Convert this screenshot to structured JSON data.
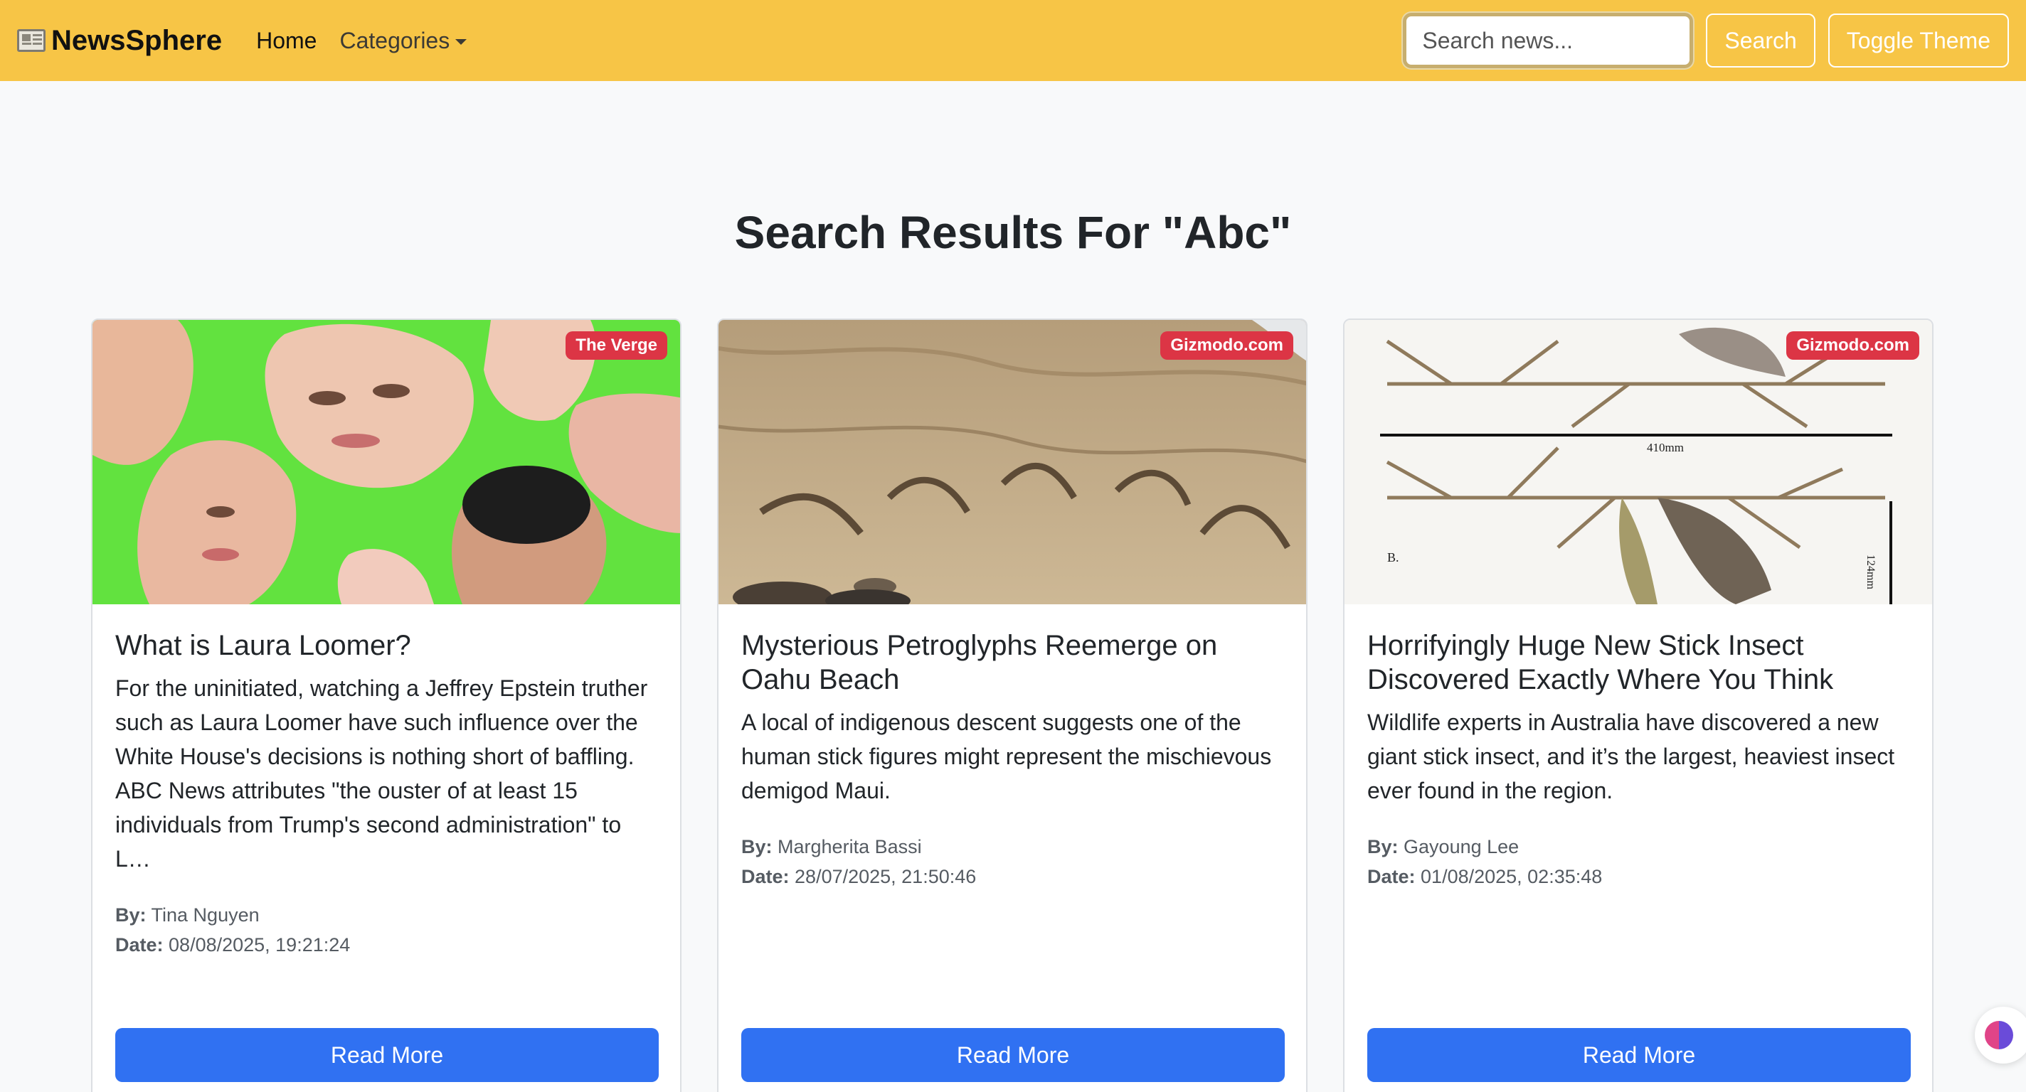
{
  "navbar": {
    "brand": "NewsSphere",
    "home": "Home",
    "categories": "Categories",
    "search_placeholder": "Search news...",
    "search_button": "Search",
    "toggle_theme": "Toggle Theme"
  },
  "heading": "Search Results For \"Abc\"",
  "cards": [
    {
      "source": "The Verge",
      "title": "What is Laura Loomer?",
      "description": "For the uninitiated, watching a Jeffrey Epstein truther such as Laura Loomer have such influence over the White House's decisions is nothing short of baffling. ABC News attributes \"the ouster of at least 15 individuals from Trump's second administration\" to L…",
      "author_label": "By:",
      "author": "Tina Nguyen",
      "date_label": "Date:",
      "date": "08/08/2025, 19:21:24",
      "button": "Read More"
    },
    {
      "source": "Gizmodo.com",
      "title": "Mysterious Petroglyphs Reemerge on Oahu Beach",
      "description": "A local of indigenous descent suggests one of the human stick figures might represent the mischievous demigod Maui.",
      "author_label": "By:",
      "author": "Margherita Bassi",
      "date_label": "Date:",
      "date": "28/07/2025, 21:50:46",
      "button": "Read More"
    },
    {
      "source": "Gizmodo.com",
      "title": "Horrifyingly Huge New Stick Insect Discovered Exactly Where You Think",
      "description": "Wildlife experts in Australia have discovered a new giant stick insect, and it’s the largest, heaviest insect ever found in the region.",
      "author_label": "By:",
      "author": "Gayoung Lee",
      "date_label": "Date:",
      "date": "01/08/2025, 02:35:48",
      "button": "Read More"
    }
  ],
  "figure_labels": {
    "length": "410mm",
    "height": "124mm",
    "panel": "B."
  }
}
